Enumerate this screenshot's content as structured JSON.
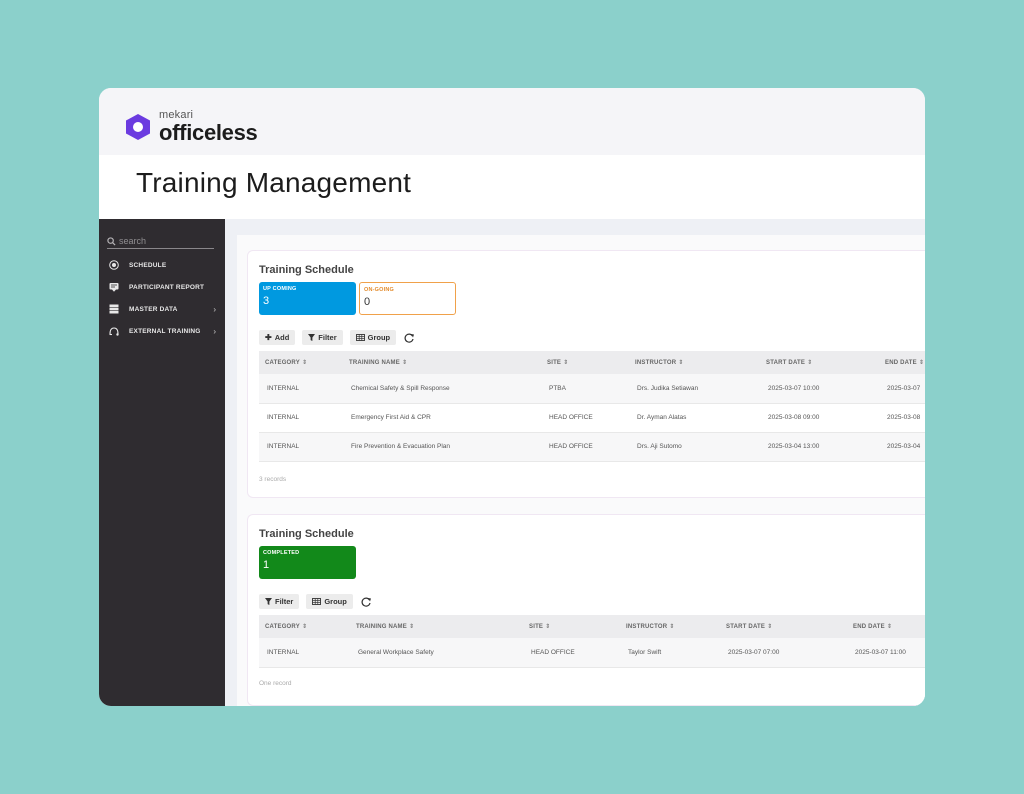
{
  "brand": {
    "small": "mekari",
    "big": "officeless",
    "color": "#6b3be0"
  },
  "page_title": "Training Management",
  "sidebar": {
    "search_placeholder": "search",
    "items": [
      {
        "label": "SCHEDULE",
        "icon": "target-icon"
      },
      {
        "label": "PARTICIPANT REPORT",
        "icon": "report-icon"
      },
      {
        "label": "MASTER DATA",
        "icon": "database-icon",
        "chevron": "›"
      },
      {
        "label": "EXTERNAL TRAINING",
        "icon": "training-icon",
        "chevron": "›"
      }
    ]
  },
  "panel1": {
    "title": "Training Schedule",
    "stats": [
      {
        "label": "UP COMING",
        "value": "3"
      },
      {
        "label": "ON-GOING",
        "value": "0"
      }
    ],
    "toolbar": {
      "add": "Add",
      "filter": "Filter",
      "group": "Group"
    },
    "columns": [
      "CATEGORY",
      "TRAINING NAME",
      "SITE",
      "INSTRUCTOR",
      "START DATE",
      "END DATE"
    ],
    "rows": [
      [
        "INTERNAL",
        "Chemical Safety & Spill Response",
        "PTBA",
        "Drs. Judika Setiawan",
        "2025-03-07 10:00",
        "2025-03-07"
      ],
      [
        "INTERNAL",
        "Emergency First Aid & CPR",
        "HEAD OFFICE",
        "Dr. Ayman Alatas",
        "2025-03-08 09:00",
        "2025-03-08"
      ],
      [
        "INTERNAL",
        "Fire Prevention & Evacuation Plan",
        "HEAD OFFICE",
        "Drs. Aji Sutomo",
        "2025-03-04 13:00",
        "2025-03-04"
      ]
    ],
    "records": "3 records"
  },
  "panel2": {
    "title": "Training Schedule",
    "stats": [
      {
        "label": "COMPLETED",
        "value": "1"
      }
    ],
    "toolbar": {
      "filter": "Filter",
      "group": "Group"
    },
    "columns": [
      "CATEGORY",
      "TRAINING NAME",
      "SITE",
      "INSTRUCTOR",
      "START DATE",
      "END DATE"
    ],
    "rows": [
      [
        "INTERNAL",
        "General Workplace Safety",
        "HEAD OFFICE",
        "Taylor Swift",
        "2025-03-07 07:00",
        "2025-03-07 11:00"
      ]
    ],
    "records": "One record"
  },
  "colors": {
    "upcoming": "#0099e0",
    "ongoing": "#f0a14a",
    "completed": "#12891a",
    "sidebar": "#2f2c30",
    "background": "#8bd0cb"
  }
}
